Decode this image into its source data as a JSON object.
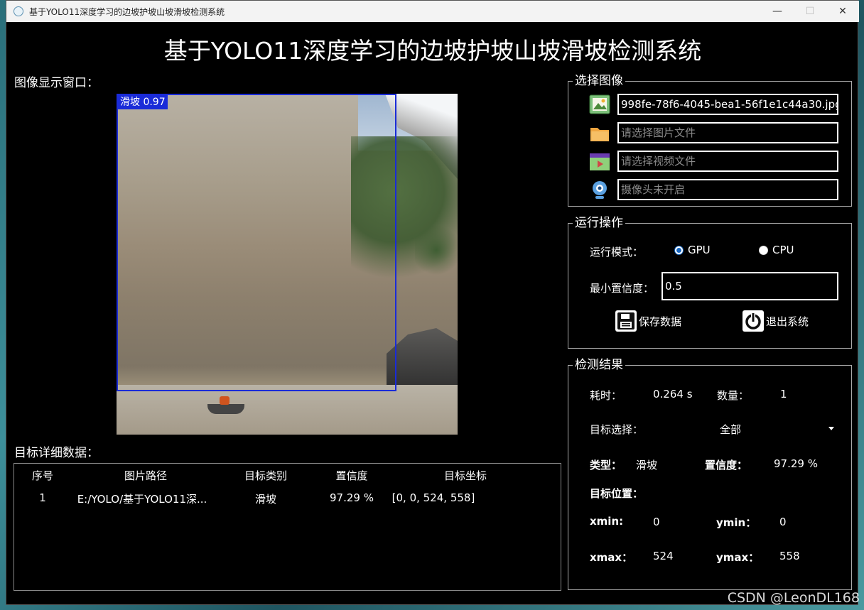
{
  "window": {
    "title": "基于YOLO11深度学习的边坡护坡山坡滑坡检测系统",
    "ctrl_min": "—",
    "ctrl_max": "☐",
    "ctrl_close": "✕"
  },
  "main_title": "基于YOLO11深度学习的边坡护坡山坡滑坡检测系统",
  "image_panel": {
    "label": "图像显示窗口：",
    "detection_label": "滑坡 0.97",
    "box_color": "#1a2bd8"
  },
  "table": {
    "label": "目标详细数据：",
    "headers": [
      "序号",
      "图片路径",
      "目标类别",
      "置信度",
      "目标坐标"
    ],
    "rows": [
      [
        "1",
        "E:/YOLO/基于YOLO11深...",
        "滑坡",
        "97.29 %",
        "[0, 0, 524, 558]"
      ]
    ]
  },
  "select_image": {
    "title": "选择图像",
    "image_file": "998fe-78f6-4045-bea1-56f1e1c44a30.jpg",
    "folder_placeholder": "请选择图片文件",
    "video_placeholder": "请选择视频文件",
    "camera_placeholder": "摄像头未开启",
    "icons": [
      "image-icon",
      "folder-icon",
      "video-icon",
      "camera-icon"
    ]
  },
  "run_ops": {
    "title": "运行操作",
    "mode_label": "运行模式：",
    "gpu_label": "GPU",
    "cpu_label": "CPU",
    "selected_mode": "GPU",
    "conf_label": "最小置信度：",
    "conf_value": "0.5",
    "save_label": "保存数据",
    "exit_label": "退出系统"
  },
  "results": {
    "title": "检测结果",
    "time_label": "耗时：",
    "time_value": "0.264 s",
    "count_label": "数量：",
    "count_value": "1",
    "target_select_label": "目标选择：",
    "target_select_value": "全部",
    "type_label": "类型：",
    "type_value": "滑坡",
    "conf_label": "置信度：",
    "conf_value": "97.29 %",
    "position_label": "目标位置：",
    "xmin_label": "xmin:",
    "xmin_value": "0",
    "ymin_label": "ymin：",
    "ymin_value": "0",
    "xmax_label": "xmax：",
    "xmax_value": "524",
    "ymax_label": "ymax：",
    "ymax_value": "558"
  },
  "watermark": "CSDN @LeonDL168"
}
